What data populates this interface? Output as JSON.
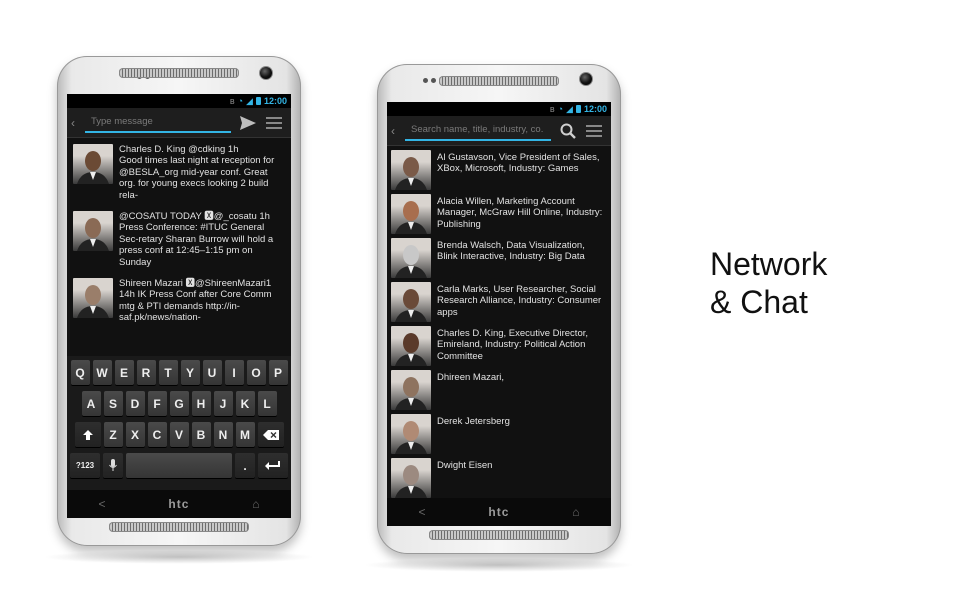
{
  "chat_screen": {
    "status": {
      "time": "12:00"
    },
    "compose": {
      "placeholder": "Type message"
    },
    "posts": [
      {
        "text": "Charles D. King @cdking  1h\nGood times last night at reception for @BESLA_org mid-year conf. Great org. for young execs looking 2 build rela-",
        "avatar_color": "#6b4a34"
      },
      {
        "text": "@COSATU TODAY 🆇@_cosatu  1h\nPress Conference: #ITUC General Sec-retary Sharan Burrow will hold a press conf at 12:45–1:15 pm on Sunday",
        "avatar_color": "#8a6a55"
      },
      {
        "text": "Shireen Mazari 🆇@ShireenMazari1\n14h IK Press Conf after Core Comm mtg & PTI demands http://in-saf.pk/news/nation-",
        "avatar_color": "#9a7e6a"
      }
    ],
    "keyboard": {
      "row1": [
        "Q",
        "W",
        "E",
        "R",
        "T",
        "Y",
        "U",
        "I",
        "O",
        "P"
      ],
      "row2": [
        "A",
        "S",
        "D",
        "F",
        "G",
        "H",
        "J",
        "K",
        "L"
      ],
      "row3": [
        "Z",
        "X",
        "C",
        "V",
        "B",
        "N",
        "M"
      ],
      "sym_label": "?123",
      "period": "."
    },
    "navbar": {
      "back": "<",
      "brand": "htc",
      "home": "⌂"
    }
  },
  "network_screen": {
    "status": {
      "time": "12:00"
    },
    "search": {
      "placeholder": "Search name, title, industry, co."
    },
    "contacts": [
      {
        "text": "Al Gustavson, Vice President of Sales, XBox, Microsoft, Industry: Games",
        "avatar_color": "#7a5a48"
      },
      {
        "text": "Alacia Willen, Marketing Account Manager, McGraw Hill Online, Industry: Publishing",
        "avatar_color": "#a86e4e"
      },
      {
        "text": "Brenda Walsch, Data Visualization, Blink Interactive, Industry: Big Data",
        "avatar_color": "#c8c8c8"
      },
      {
        "text": "Carla Marks, User Researcher, Social Research Alliance, Industry: Consumer apps",
        "avatar_color": "#6a4a38"
      },
      {
        "text": "Charles D. King, Executive Director, Emireland, Industry: Political Action Committee",
        "avatar_color": "#5a3a2a"
      },
      {
        "text": "Dhireen Mazari,",
        "avatar_color": "#8e735f"
      },
      {
        "text": "Derek Jetersberg",
        "avatar_color": "#b08a74"
      },
      {
        "text": "Dwight Eisen",
        "avatar_color": "#9c8a80"
      }
    ],
    "navbar": {
      "back": "<",
      "brand": "htc",
      "home": "⌂"
    }
  },
  "tagline": {
    "line1": "Network",
    "line2": "& Chat"
  }
}
